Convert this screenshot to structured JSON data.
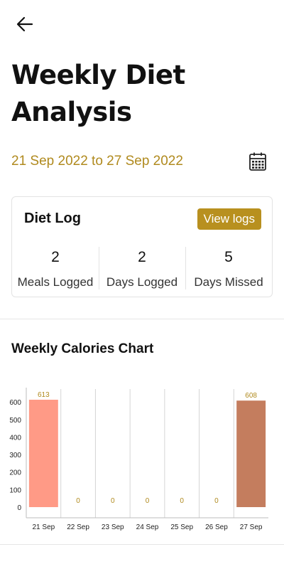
{
  "header": {
    "back_icon": "arrow-left-icon",
    "title": "Weekly Diet Analysis",
    "date_range": "21 Sep 2022 to 27 Sep 2022",
    "calendar_icon": "calendar-icon"
  },
  "diet_log": {
    "title": "Diet Log",
    "view_logs_label": "View logs",
    "stats": [
      {
        "value": "2",
        "label": "Meals Logged"
      },
      {
        "value": "2",
        "label": "Days Logged"
      },
      {
        "value": "5",
        "label": "Days Missed"
      }
    ]
  },
  "chart_section": {
    "title": "Weekly Calories Chart"
  },
  "colors": {
    "accent": "#b8901f",
    "date_text": "#b08a1e",
    "bar_first": "#ff9a86",
    "bar_last": "#c47d5e",
    "value_label": "#b08a1e"
  },
  "chart_data": {
    "type": "bar",
    "categories": [
      "21 Sep",
      "22 Sep",
      "23 Sep",
      "24 Sep",
      "25 Sep",
      "26 Sep",
      "27 Sep"
    ],
    "values": [
      613,
      0,
      0,
      0,
      0,
      0,
      608
    ],
    "value_labels": [
      "613",
      "0",
      "0",
      "0",
      "0",
      "0",
      "608"
    ],
    "y_ticks": [
      0,
      100,
      200,
      300,
      400,
      500,
      600
    ],
    "ylim": [
      0,
      613
    ],
    "grid": "vertical",
    "legend": "none"
  }
}
